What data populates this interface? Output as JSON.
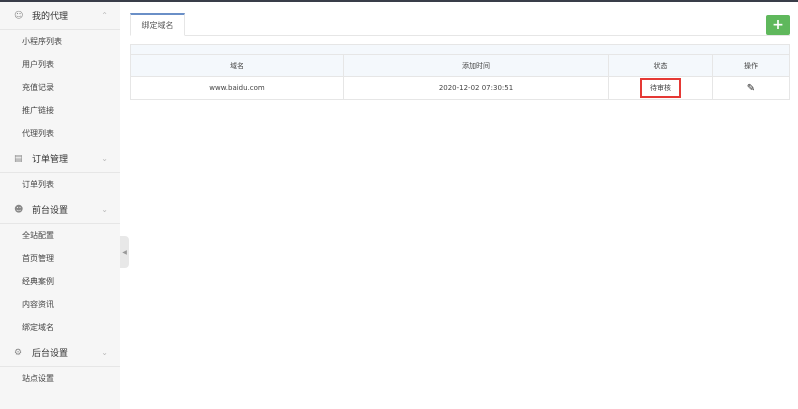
{
  "sidebar": {
    "groups": [
      {
        "label": "我的代理",
        "icon": "user-icon",
        "expanded": true,
        "items": [
          "小程序列表",
          "用户列表",
          "充值记录",
          "推广链接",
          "代理列表"
        ]
      },
      {
        "label": "订单管理",
        "icon": "bag-icon",
        "expanded": false,
        "items": [
          "订单列表"
        ]
      },
      {
        "label": "前台设置",
        "icon": "users-icon",
        "expanded": false,
        "items": [
          "全站配置",
          "首页管理",
          "经典案例",
          "内容资讯",
          "绑定域名"
        ]
      },
      {
        "label": "后台设置",
        "icon": "gear-icon",
        "expanded": false,
        "items": [
          "站点设置"
        ]
      }
    ]
  },
  "tab": {
    "label": "绑定域名"
  },
  "add_button": {
    "label": "+"
  },
  "table": {
    "headers": [
      "域名",
      "添加时间",
      "状态",
      "操作"
    ],
    "rows": [
      {
        "domain": "www.baidu.com",
        "time": "2020-12-02 07:30:51",
        "status": "待审核"
      }
    ]
  },
  "colors": {
    "accent_green": "#5fb85c",
    "highlight_red": "#e53935"
  }
}
